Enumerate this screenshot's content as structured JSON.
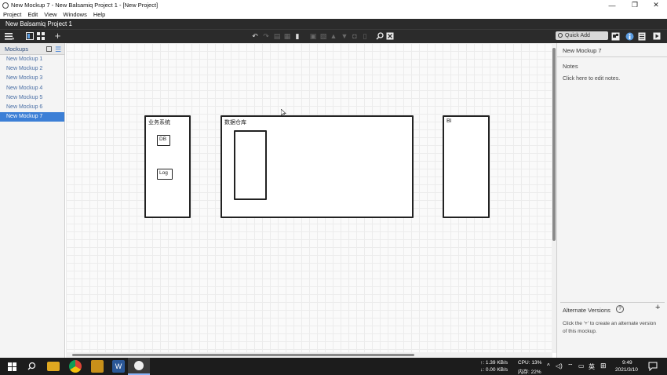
{
  "window": {
    "title": "New Mockup 7 - New Balsamiq Project 1 - [New Project]",
    "controls": [
      "—",
      "❐",
      "✕"
    ]
  },
  "menu": [
    "Project",
    "Edit",
    "View",
    "Windows",
    "Help"
  ],
  "project_name": "New Balsamiq Project 1",
  "quick_add": {
    "placeholder": "Quick Add"
  },
  "left_panel": {
    "heading": "Mockups",
    "items": [
      "New Mockup 1",
      "New Mockup 2",
      "New Mockup 3",
      "New Mockup 4",
      "New Mockup 5",
      "New Mockup 6",
      "New Mockup 7"
    ],
    "selected_index": 6
  },
  "canvas": {
    "boxes": {
      "business": {
        "label": "业务系统",
        "db": "DB",
        "log": "Log"
      },
      "warehouse": {
        "label": "数据仓库"
      },
      "bi": {
        "label": "BI"
      }
    }
  },
  "right_panel": {
    "mockup_name": "New Mockup 7",
    "notes_heading": "Notes",
    "notes_hint": "Click here to edit notes.",
    "alt_versions": "Alternate Versions",
    "alt_help": "?",
    "alt_desc": "Click the '+' to create an alternate version of this mockup."
  },
  "taskbar": {
    "net_up": "↑: 1.39 KB/s",
    "net_down": "↓: 0.00 KB/s",
    "cpu": "CPU: 13%",
    "mem": "内存: 22%",
    "ime": "英",
    "time": "9:49",
    "date": "2021/3/10"
  }
}
